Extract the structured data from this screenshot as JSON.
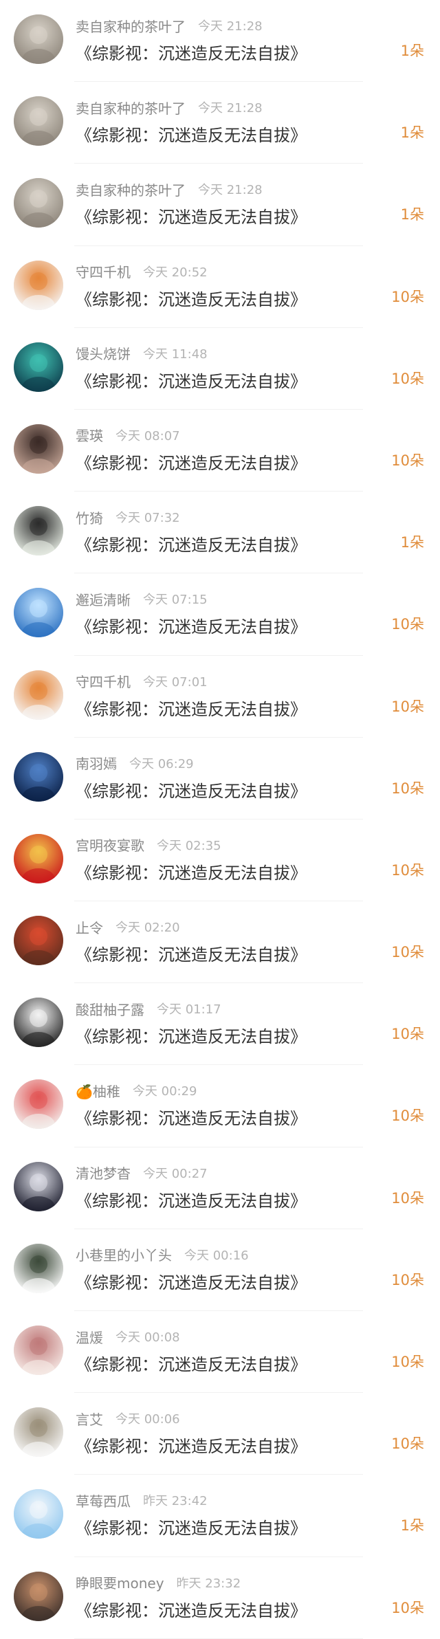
{
  "book_title": "《综影视：沉迷造反无法自拔》",
  "items": [
    {
      "name": "卖自家种的茶叶了",
      "time": "今天 21:28",
      "count": "1朵",
      "avatar": "avatar-girl-sepia",
      "c1": "#8c8479",
      "c2": "#d8d2c8"
    },
    {
      "name": "卖自家种的茶叶了",
      "time": "今天 21:28",
      "count": "1朵",
      "avatar": "avatar-girl-sepia",
      "c1": "#8c8479",
      "c2": "#d8d2c8"
    },
    {
      "name": "卖自家种的茶叶了",
      "time": "今天 21:28",
      "count": "1朵",
      "avatar": "avatar-girl-sepia",
      "c1": "#8c8479",
      "c2": "#d8d2c8"
    },
    {
      "name": "守四千机",
      "time": "今天 20:52",
      "count": "10朵",
      "avatar": "avatar-cat-laptop",
      "c1": "#f6f6f6",
      "c2": "#e6863a"
    },
    {
      "name": "馒头烧饼",
      "time": "今天 11:48",
      "count": "10朵",
      "avatar": "avatar-galaxy",
      "c1": "#0d3a4a",
      "c2": "#3fbfb0"
    },
    {
      "name": "雲瑛",
      "time": "今天 08:07",
      "count": "10朵",
      "avatar": "avatar-girl-portrait",
      "c1": "#c9a99a",
      "c2": "#3a2a26"
    },
    {
      "name": "竹猗",
      "time": "今天 07:32",
      "count": "1朵",
      "avatar": "avatar-boy-portrait",
      "c1": "#e9efe6",
      "c2": "#2b2b2b"
    },
    {
      "name": "邂逅清晰",
      "time": "今天 07:15",
      "count": "10朵",
      "avatar": "avatar-ice-princess",
      "c1": "#2a6fc0",
      "c2": "#bfe2ff"
    },
    {
      "name": "守四千机",
      "time": "今天 07:01",
      "count": "10朵",
      "avatar": "avatar-cat-laptop",
      "c1": "#f6f6f6",
      "c2": "#e6863a"
    },
    {
      "name": "南羽嫣",
      "time": "今天 06:29",
      "count": "10朵",
      "avatar": "avatar-night-sky",
      "c1": "#0a1f45",
      "c2": "#4f7fc4"
    },
    {
      "name": "宫明夜宴歌",
      "time": "今天 02:35",
      "count": "10朵",
      "avatar": "avatar-red-lucky",
      "c1": "#c9141b",
      "c2": "#f2c14a"
    },
    {
      "name": "止令",
      "time": "今天 02:20",
      "count": "10朵",
      "avatar": "avatar-opera",
      "c1": "#5b2d1e",
      "c2": "#d84b2f"
    },
    {
      "name": "酸甜柚子露",
      "time": "今天 01:17",
      "count": "10朵",
      "avatar": "avatar-man-dark",
      "c1": "#1f1f1f",
      "c2": "#f3f3f3"
    },
    {
      "name": "🍊柚稚",
      "time": "今天 00:29",
      "count": "10朵",
      "avatar": "avatar-cartoon-kid",
      "c1": "#f4f1ef",
      "c2": "#e25555"
    },
    {
      "name": "清池梦杳",
      "time": "今天 00:27",
      "count": "10朵",
      "avatar": "avatar-dark-cat",
      "c1": "#1b1c2c",
      "c2": "#dcdde6"
    },
    {
      "name": "小巷里的小丫头",
      "time": "今天 00:16",
      "count": "10朵",
      "avatar": "avatar-chibi-boy",
      "c1": "#ffffff",
      "c2": "#3d4a3a"
    },
    {
      "name": "温煖",
      "time": "今天 00:08",
      "count": "10朵",
      "avatar": "avatar-flower-girl",
      "c1": "#f7ece8",
      "c2": "#c07a7a"
    },
    {
      "name": "言艾",
      "time": "今天 00:06",
      "count": "10朵",
      "avatar": "avatar-ink-figure",
      "c1": "#fafafa",
      "c2": "#9a8f7a"
    },
    {
      "name": "草莓西瓜",
      "time": "昨天 23:42",
      "count": "1朵",
      "avatar": "avatar-sky-figure",
      "c1": "#8fc7ef",
      "c2": "#f0f6fb"
    },
    {
      "name": "睁眼要money",
      "time": "昨天 23:32",
      "count": "10朵",
      "avatar": "avatar-group-photo",
      "c1": "#3a2e2a",
      "c2": "#c78f6a"
    }
  ]
}
